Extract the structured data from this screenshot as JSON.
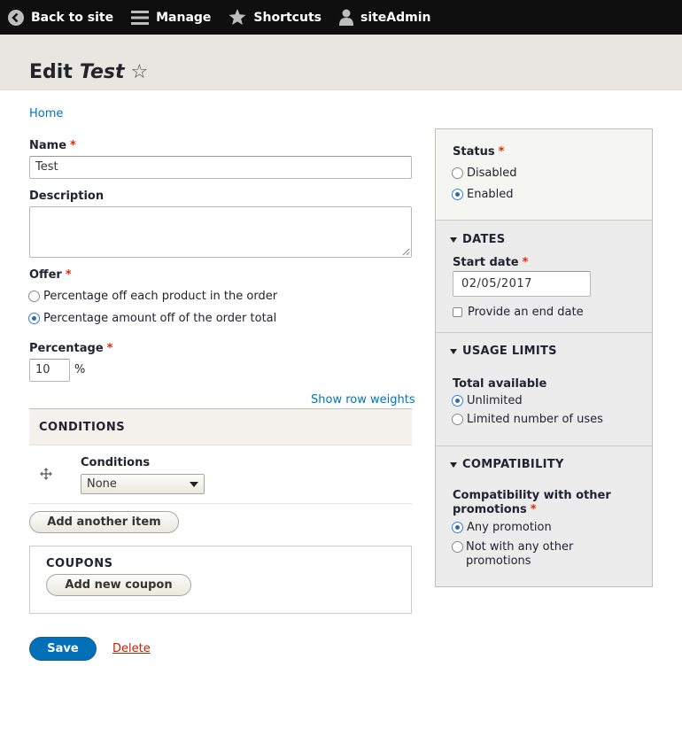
{
  "toolbar": {
    "back": "Back to site",
    "manage": "Manage",
    "shortcuts": "Shortcuts",
    "user": "siteAdmin"
  },
  "header": {
    "title_prefix": "Edit",
    "title_name": "Test",
    "star_glyph": "☆"
  },
  "breadcrumb": {
    "home": "Home"
  },
  "form": {
    "name_label": "Name",
    "name_value": "Test",
    "description_label": "Description",
    "description_value": "",
    "offer_label": "Offer",
    "offer_options": [
      "Percentage off each product in the order",
      "Percentage amount off of the order total"
    ],
    "offer_selected_index": 1,
    "percentage_label": "Percentage",
    "percentage_value": "10",
    "percentage_suffix": "%",
    "show_row_weights": "Show row weights",
    "conditions_header": "CONDITIONS",
    "conditions_label": "Conditions",
    "conditions_select_value": "None",
    "add_another_item": "Add another item",
    "coupons_title": "COUPONS",
    "add_new_coupon": "Add new coupon",
    "save": "Save",
    "delete": "Delete",
    "required_mark": "*"
  },
  "sidebar": {
    "status_label": "Status",
    "status_options": [
      "Disabled",
      "Enabled"
    ],
    "status_selected_index": 1,
    "dates_title": "DATES",
    "start_date_label": "Start date",
    "start_date_value": "02/05/2017",
    "end_date_checkbox": "Provide an end date",
    "usage_title": "USAGE LIMITS",
    "total_available_label": "Total available",
    "usage_options": [
      "Unlimited",
      "Limited number of uses"
    ],
    "usage_selected_index": 0,
    "compat_title": "COMPATIBILITY",
    "compat_label": "Compatibility with other promotions",
    "compat_options": [
      "Any promotion",
      "Not with any other promotions"
    ],
    "compat_selected_index": 0
  },
  "colors": {
    "accent": "#0074bd",
    "required": "#e62600",
    "save_button": "#0071b8",
    "delete_link": "#c72100",
    "toolbar_bg": "#0f0f0f"
  }
}
